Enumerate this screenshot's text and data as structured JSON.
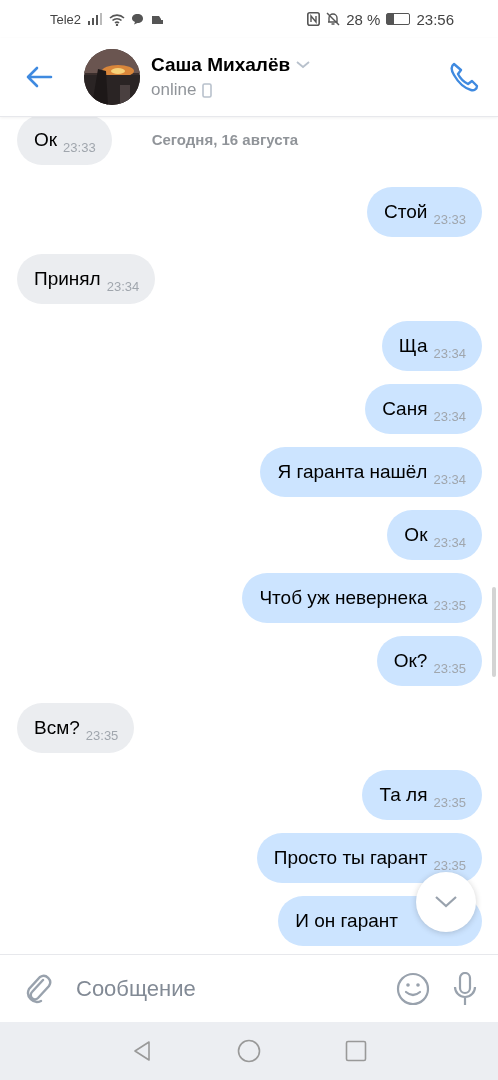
{
  "status_bar": {
    "carrier": "Tele2",
    "battery_percent": "28 %",
    "time": "23:56"
  },
  "header": {
    "name": "Саша Михалёв",
    "status": "online"
  },
  "date_label": "Сегодня, 16 августа",
  "messages": [
    {
      "kind": "in",
      "text": "Ок",
      "time": "23:33"
    },
    {
      "kind": "out",
      "text": "Стой",
      "time": "23:33"
    },
    {
      "kind": "in",
      "text": "Принял",
      "time": "23:34"
    },
    {
      "kind": "out",
      "text": "Ща",
      "time": "23:34"
    },
    {
      "kind": "out",
      "text": "Саня",
      "time": "23:34"
    },
    {
      "kind": "out",
      "text": "Я гаранта нашёл",
      "time": "23:34"
    },
    {
      "kind": "out",
      "text": "Ок",
      "time": "23:34"
    },
    {
      "kind": "out",
      "text": "Чтоб уж невернека",
      "time": "23:35"
    },
    {
      "kind": "out",
      "text": "Ок?",
      "time": "23:35"
    },
    {
      "kind": "in",
      "text": "Всм?",
      "time": "23:35"
    },
    {
      "kind": "out",
      "text": "Та ля",
      "time": "23:35"
    },
    {
      "kind": "out",
      "text": "Просто ты гарант",
      "time": "23:35"
    },
    {
      "kind": "out",
      "text": "И он гарант"
    }
  ],
  "composer": {
    "placeholder": "Сообщение"
  }
}
